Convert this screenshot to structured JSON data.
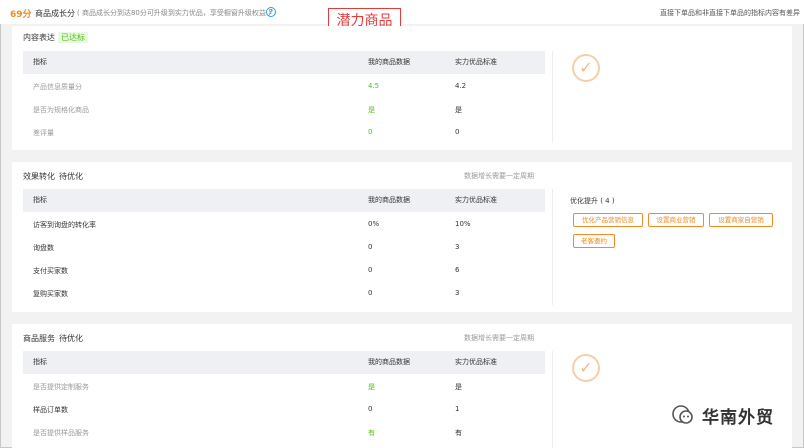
{
  "topbar": {
    "score": "69分",
    "growth_title": "商品成长分",
    "growth_note": "( 商品成长分到达80分可升级到实力优品，享受橱窗升级权益 )",
    "top_right_note": "直接下单品和非直接下单品的指标内容有差异",
    "stamp": "潜力商品"
  },
  "colors": {
    "accent": "#f08a24",
    "success": "#52c41a",
    "stamp_red": "#e23b3b",
    "help_blue": "#2a9fd6"
  },
  "columns": {
    "metric": "指标",
    "mine": "我的商品数据",
    "standard": "实力优品标准"
  },
  "content_section": {
    "title": "内容表达",
    "status": "已达标",
    "rows": [
      {
        "metric": "产品信息质量分",
        "mine": "4.5",
        "standard": "4.2"
      },
      {
        "metric": "是否为规格化商品",
        "mine": "是",
        "standard": "是"
      },
      {
        "metric": "差评量",
        "mine": "0",
        "standard": "0"
      }
    ]
  },
  "conversion_section": {
    "title": "效果转化",
    "status": "待优化",
    "note": "数据增长需要一定周期",
    "rows": [
      {
        "metric": "访客到询盘的转化率",
        "mine": "0%",
        "standard": "10%"
      },
      {
        "metric": "询盘数",
        "mine": "0",
        "standard": "3"
      },
      {
        "metric": "支付买家数",
        "mine": "0",
        "standard": "6"
      },
      {
        "metric": "复购买家数",
        "mine": "0",
        "standard": "3"
      }
    ],
    "optimize_title": "优化提升 ( 4 )",
    "optimize_buttons": [
      "优化产品营销信息",
      "设置商业营销",
      "设置商家自营销",
      "老客邀约"
    ]
  },
  "service_section": {
    "title": "商品服务",
    "status": "待优化",
    "note": "数据增长需要一定周期",
    "rows": [
      {
        "metric": "是否提供定制服务",
        "mine": "是",
        "standard": "是"
      },
      {
        "metric": "样品订单数",
        "mine": "0",
        "standard": "1"
      },
      {
        "metric": "是否提供样品服务",
        "mine": "有",
        "standard": "有"
      }
    ]
  },
  "watermark": {
    "text": "华南外贸",
    "icon": "wechat-official-account-icon"
  },
  "icons": {
    "help": "question-circle-icon",
    "done": "checkmark-circle-icon"
  }
}
